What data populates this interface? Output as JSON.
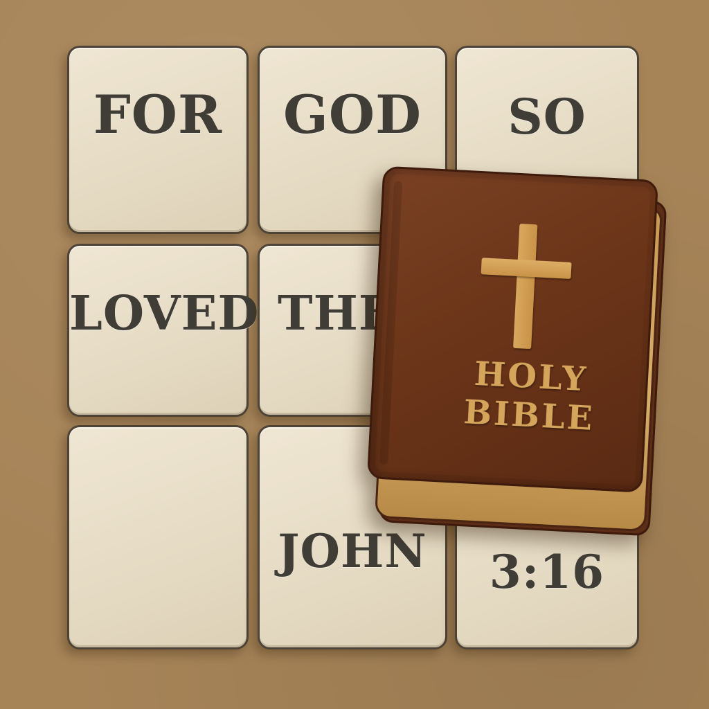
{
  "puzzle": {
    "tiles": [
      {
        "id": "t1",
        "word": "FOR"
      },
      {
        "id": "t2",
        "word": "GOD"
      },
      {
        "id": "t3",
        "word": "SO"
      },
      {
        "id": "t4",
        "word": "LOVED"
      },
      {
        "id": "t5",
        "word": "THE"
      },
      {
        "id": "t6",
        "word": ""
      },
      {
        "id": "t7",
        "word": ""
      },
      {
        "id": "t8",
        "word": "JOHN"
      },
      {
        "id": "t9",
        "word": "3:16"
      }
    ]
  },
  "bible": {
    "title_line_1": "HOLY",
    "title_line_2": "BIBLE",
    "icon": "cross-icon"
  },
  "colors": {
    "background": "#a78458",
    "tile": "#e9e0cb",
    "tile_text": "#3f3d36",
    "bible_cover": "#6b3519",
    "gold": "#d6a55c"
  }
}
